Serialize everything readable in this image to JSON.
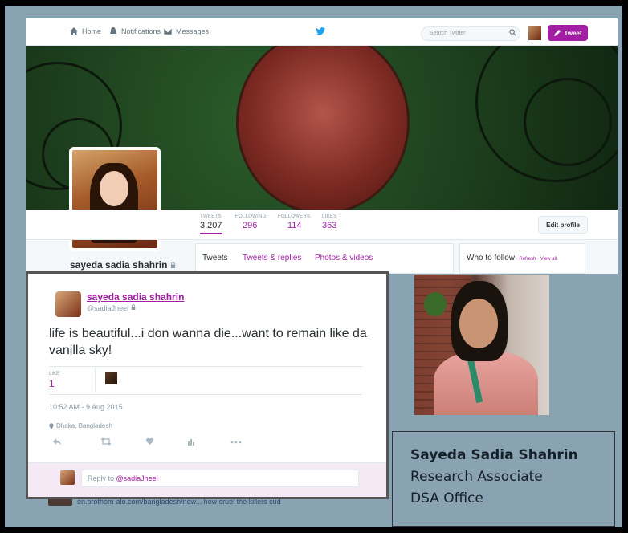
{
  "twitter": {
    "nav": {
      "home": "Home",
      "notifications": "Notifications",
      "messages": "Messages",
      "search_placeholder": "Search Twitter",
      "tweet_button": "Tweet"
    },
    "stats": [
      {
        "label": "TWEETS",
        "value": "3,207"
      },
      {
        "label": "FOLLOWING",
        "value": "296"
      },
      {
        "label": "FOLLOWERS",
        "value": "114"
      },
      {
        "label": "LIKES",
        "value": "363"
      }
    ],
    "edit_profile": "Edit profile",
    "profile_name": "sayeda sadia shahrin",
    "tabs": [
      "Tweets",
      "Tweets & replies",
      "Photos & videos"
    ],
    "who_to_follow": "Who to follow",
    "who_to_follow_links": " · Refresh · View all"
  },
  "tweet": {
    "name": "sayeda sadia shahrin",
    "handle": "@sadiaJheel",
    "text": "life is beautiful...i don wanna die...want to remain like da vanilla sky!",
    "like_label": "LIKE",
    "like_count": "1",
    "timestamp": "10:52 AM - 9 Aug 2015",
    "location": "Dhaka, Bangladesh",
    "reply_prefix": "Reply to ",
    "reply_handle": "@sadiaJheel"
  },
  "under_text": "en.prothom-alo.com/bangladesh/new... how cruel the killers cud",
  "caption": {
    "name": "Sayeda Sadia Shahrin",
    "title": "Research Associate",
    "office": "DSA Office"
  },
  "colors": {
    "accent": "#a21fa4",
    "slide_bg": "#8aa3b3"
  }
}
